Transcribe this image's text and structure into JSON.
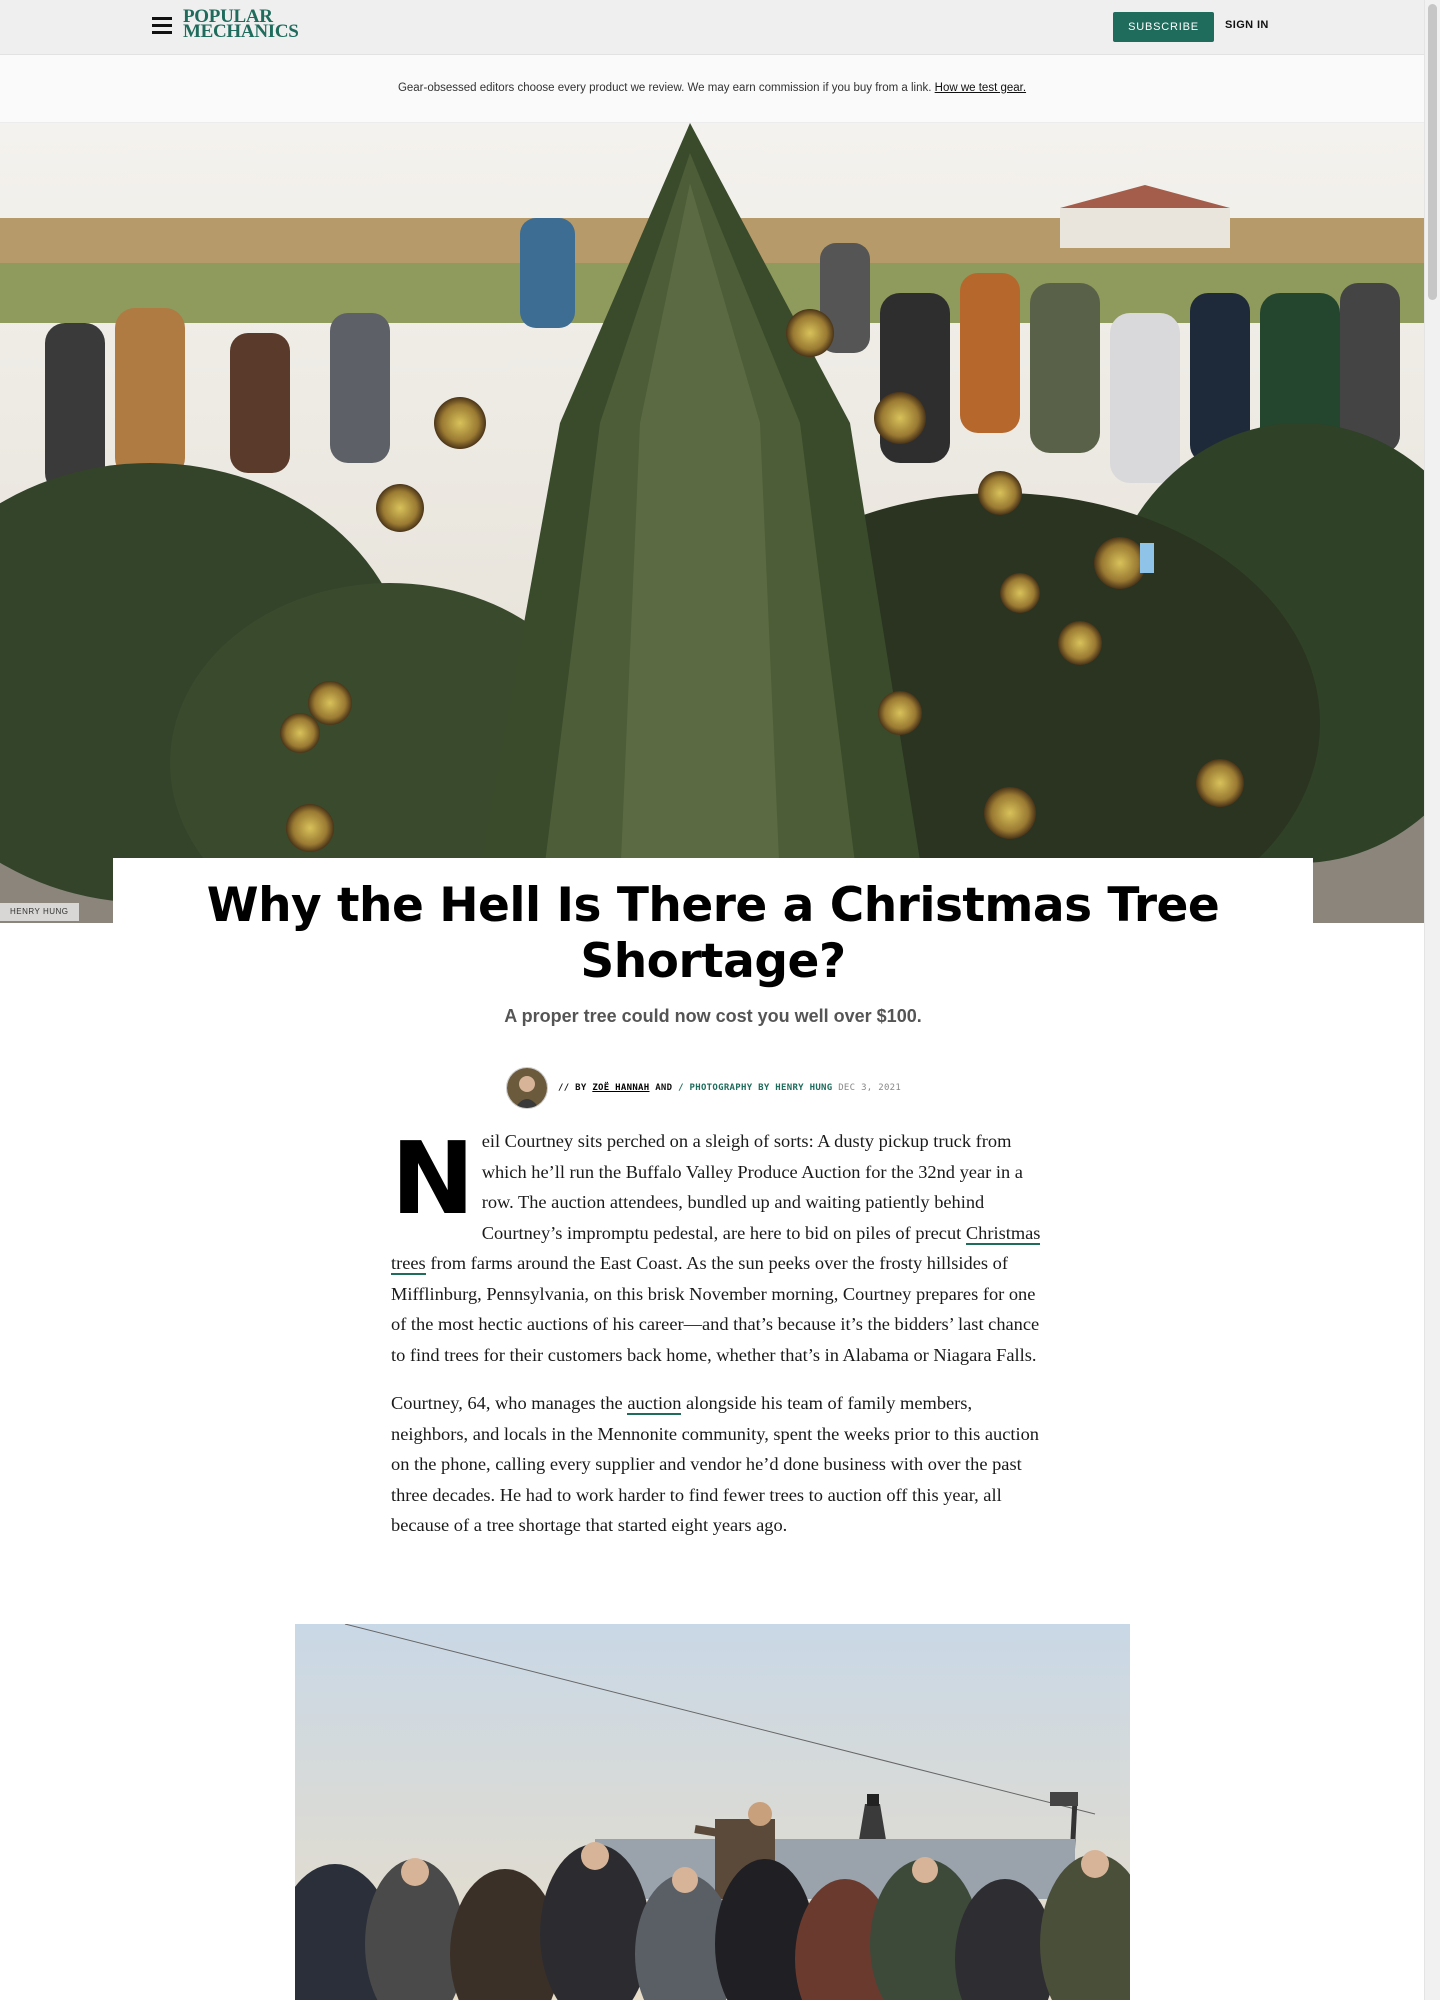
{
  "header": {
    "logo_line1": "POPULAR",
    "logo_line2": "MECHANICS",
    "subscribe_label": "SUBSCRIBE",
    "signin_label": "SIGN IN"
  },
  "disclosure": {
    "text": "Gear-obsessed editors choose every product we review. We may earn commission if you buy from a link.",
    "link": "How we test gear."
  },
  "hero": {
    "credit": "HENRY HUNG"
  },
  "article": {
    "title": "Why the Hell Is There a Christmas Tree Shortage?",
    "dek": "A proper tree could now cost you well over $100.",
    "byline": {
      "prefix": "// BY",
      "author": "ZOË HANNAH",
      "and": "AND",
      "photo": "/ PHOTOGRAPHY BY HENRY HUNG",
      "date": "DEC 3, 2021"
    },
    "p1": {
      "dropcap": "N",
      "a": "eil Courtney sits perched on a sleigh of sorts: A dusty pickup truck from which he’ll run the Buffalo Valley Produce Auction for the 32nd year in a row. The auction attendees, bundled up and waiting patiently behind Courtney’s impromptu pedestal, are here to bid on piles of precut ",
      "link": "Christmas trees",
      "b": " from farms around the East Coast. As the sun peeks over the frosty hillsides of Mifflinburg, Pennsylvania, on this brisk November morning, Courtney prepares for one of the most hectic auctions of his career—and that’s because it’s the bidders’ last chance to find trees for their customers back home, whether that’s in Alabama or Niagara Falls."
    },
    "p2": {
      "a": "Courtney, 64, who manages the ",
      "link": "auction",
      "b": " alongside his team of family members, neighbors, and locals in the Mennonite community, spent the weeks prior to this auction on the phone, calling every supplier and vendor he’d done business with over the past three decades. He had to work harder to find fewer trees to auction off this year, all because of a tree shortage that started eight years ago."
    }
  },
  "colors": {
    "brand": "#1f6b5c",
    "text": "#1a1a1a"
  }
}
